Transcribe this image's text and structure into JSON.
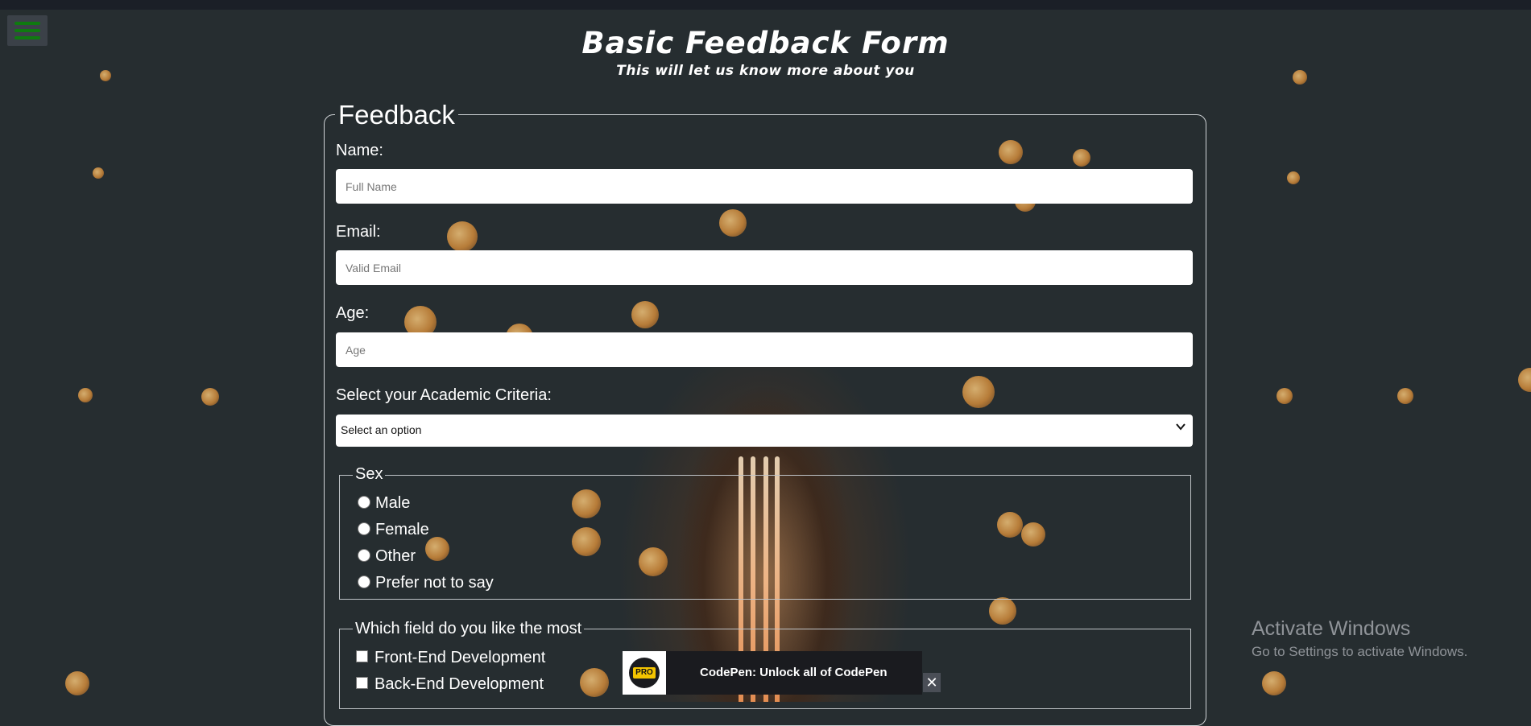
{
  "header": {
    "title": "Basic Feedback Form",
    "subtitle": "This will let us know more about you"
  },
  "menu": {
    "icon": "hamburger-menu-icon"
  },
  "form": {
    "legend": "Feedback",
    "name": {
      "label": "Name:",
      "placeholder": "Full Name"
    },
    "email": {
      "label": "Email:",
      "placeholder": "Valid Email"
    },
    "age": {
      "label": "Age:",
      "placeholder": "Age"
    },
    "criteria": {
      "label": "Select your Academic Criteria:",
      "selected": "Select an option"
    },
    "sex": {
      "legend": "Sex",
      "options": [
        "Male",
        "Female",
        "Other",
        "Prefer not to say"
      ]
    },
    "fields": {
      "legend": "Which field do you like the most",
      "options": [
        "Front-End Development",
        "Back-End Development"
      ]
    }
  },
  "windows_watermark": {
    "title": "Activate Windows",
    "subtitle": "Go to Settings to activate Windows."
  },
  "codepen_promo": {
    "badge": "PRO",
    "text": "CodePen: Unlock all of CodePen",
    "close": "✕"
  },
  "colors": {
    "background": "#262d30",
    "hamburger": "#0f7a10",
    "pro_badge": "#f4c400"
  }
}
